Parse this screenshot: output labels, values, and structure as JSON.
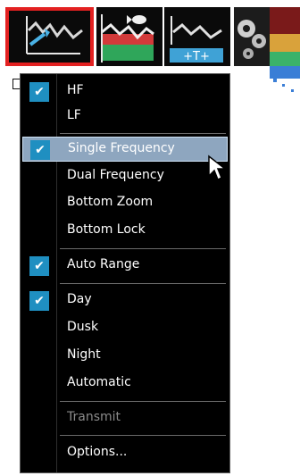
{
  "toolbar": {
    "buttons": [
      {
        "icon": "sonar-range-arrow-icon",
        "selected": true
      },
      {
        "icon": "sonar-fish-icon",
        "selected": false
      },
      {
        "icon": "sonar-zoom-controls-icon",
        "selected": false
      },
      {
        "icon": "gears-settings-icon",
        "selected": false
      }
    ],
    "selected_border_color": "#e32121"
  },
  "menu": {
    "check_mark": "✔",
    "check_color": "#1f8fc1",
    "highlight_color": "#8ea6bf",
    "items": [
      {
        "label": "HF",
        "checked": true
      },
      {
        "label": "LF",
        "checked": false
      },
      {
        "label": "Single Frequency",
        "checked": true,
        "highlighted": true
      },
      {
        "label": "Dual Frequency",
        "checked": false
      },
      {
        "label": "Bottom Zoom",
        "checked": false
      },
      {
        "label": "Bottom Lock",
        "checked": false
      },
      {
        "label": "Auto Range",
        "checked": true
      },
      {
        "label": "Day",
        "checked": true
      },
      {
        "label": "Dusk",
        "checked": false
      },
      {
        "label": "Night",
        "checked": false
      },
      {
        "label": "Automatic",
        "checked": false
      },
      {
        "label": "Transmit",
        "checked": false,
        "disabled": true
      },
      {
        "label": "Options...",
        "checked": false
      }
    ]
  }
}
